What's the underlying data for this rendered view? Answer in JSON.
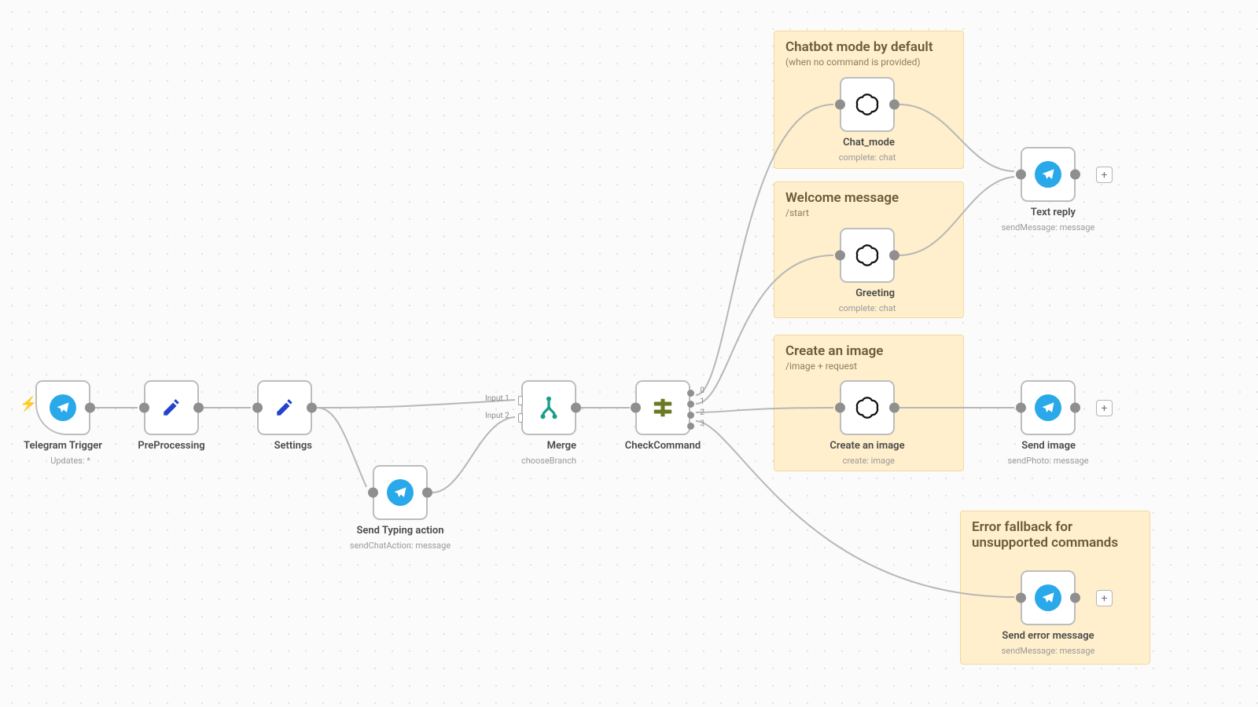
{
  "stickies": {
    "chatmode": {
      "title": "Chatbot mode by default",
      "sub": "(when no command is provided)"
    },
    "welcome": {
      "title": "Welcome message",
      "sub": "/start"
    },
    "image": {
      "title": "Create an image",
      "sub": "/image + request"
    },
    "error": {
      "title": "Error fallback for unsupported commands",
      "sub": ""
    }
  },
  "nodes": {
    "trigger": {
      "name": "Telegram Trigger",
      "meta": "Updates: *"
    },
    "preproc": {
      "name": "PreProcessing",
      "meta": ""
    },
    "settings": {
      "name": "Settings",
      "meta": ""
    },
    "typing": {
      "name": "Send Typing action",
      "meta": "sendChatAction: message"
    },
    "merge": {
      "name": "Merge",
      "meta": "chooseBranch",
      "in1": "Input 1",
      "in2": "Input 2"
    },
    "check": {
      "name": "CheckCommand",
      "meta": "",
      "o0": "0",
      "o1": "1",
      "o2": "2",
      "o3": "3"
    },
    "chat": {
      "name": "Chat_mode",
      "meta": "complete: chat"
    },
    "greet": {
      "name": "Greeting",
      "meta": "complete: chat"
    },
    "img": {
      "name": "Create an image",
      "meta": "create: image"
    },
    "textreply": {
      "name": "Text reply",
      "meta": "sendMessage: message"
    },
    "sendimg": {
      "name": "Send image",
      "meta": "sendPhoto: message"
    },
    "senderr": {
      "name": "Send error message",
      "meta": "sendMessage: message"
    }
  }
}
